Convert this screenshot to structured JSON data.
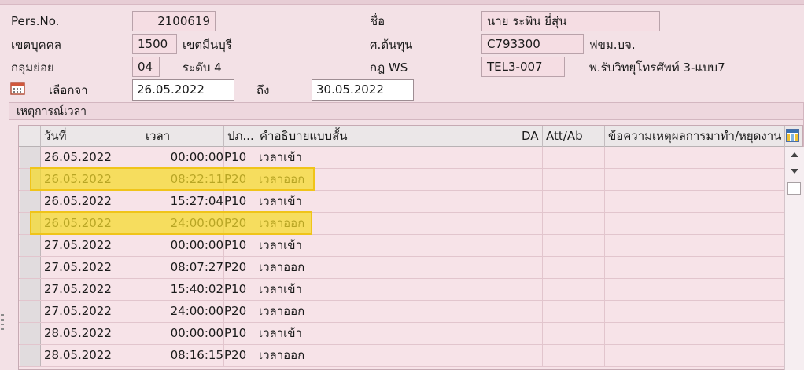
{
  "header": {
    "pers_no_label": "Pers.No.",
    "pers_no_value": "2100619",
    "name_label": "ชื่อ",
    "name_value": "นาย ระพิน ยี่สุ่น",
    "area_label": "เขตบุคคล",
    "area_code": "1500",
    "area_name": "เขตมีนบุรี",
    "cost_center_label": "ศ.ต้นทุน",
    "cost_center_code": "C793300",
    "cost_center_name": "ฟขม.บจ.",
    "subgroup_label": "กลุ่มย่อย",
    "subgroup_code": "04",
    "level_text": "ระดับ 4",
    "ws_label": "กฎ WS",
    "ws_code": "TEL3-007",
    "ws_desc": "พ.รับวิทยุโทรศัพท์ 3-แบบ7",
    "select_from_label": "เลือกจา",
    "date_from": "26.05.2022",
    "to_label": "ถึง",
    "date_to": "30.05.2022"
  },
  "icons": {
    "calendar": "calendar-icon",
    "column_settings": "column-settings-icon",
    "scroll_up": "triangle-up",
    "scroll_down": "triangle-down"
  },
  "group": {
    "title": "เหตุการณ์เวลา"
  },
  "table": {
    "columns": [
      "วันที่",
      "เวลา",
      "ปภ...",
      "คำอธิบายแบบสั้น",
      "DA",
      "Att/Ab",
      "ข้อความเหตุผลการมาทำ/หยุดงาน"
    ],
    "rows": [
      {
        "date": "26.05.2022",
        "time": "00:00:00",
        "type": "P10",
        "desc": "เวลาเข้า",
        "highlighted": false
      },
      {
        "date": "26.05.2022",
        "time": "08:22:11",
        "type": "P20",
        "desc": "เวลาออก",
        "highlighted": true
      },
      {
        "date": "26.05.2022",
        "time": "15:27:04",
        "type": "P10",
        "desc": "เวลาเข้า",
        "highlighted": false
      },
      {
        "date": "26.05.2022",
        "time": "24:00:00",
        "type": "P20",
        "desc": "เวลาออก",
        "highlighted": true
      },
      {
        "date": "27.05.2022",
        "time": "00:00:00",
        "type": "P10",
        "desc": "เวลาเข้า",
        "highlighted": false
      },
      {
        "date": "27.05.2022",
        "time": "08:07:27",
        "type": "P20",
        "desc": "เวลาออก",
        "highlighted": false
      },
      {
        "date": "27.05.2022",
        "time": "15:40:02",
        "type": "P10",
        "desc": "เวลาเข้า",
        "highlighted": false
      },
      {
        "date": "27.05.2022",
        "time": "24:00:00",
        "type": "P20",
        "desc": "เวลาออก",
        "highlighted": false
      },
      {
        "date": "28.05.2022",
        "time": "00:00:00",
        "type": "P10",
        "desc": "เวลาเข้า",
        "highlighted": false
      },
      {
        "date": "28.05.2022",
        "time": "08:16:15",
        "type": "P20",
        "desc": "เวลาออก",
        "highlighted": false
      }
    ]
  },
  "colors": {
    "background": "#f3e1e6",
    "readonly_field": "#f5dde3",
    "highlight": "#f5db28"
  }
}
